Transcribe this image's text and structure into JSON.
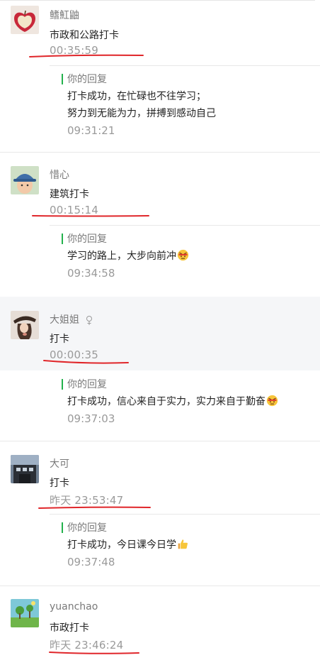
{
  "posts": [
    {
      "user": "鳍魟鼬",
      "text": "市政和公路打卡",
      "time": "00:35:59",
      "reply": {
        "label": "你的回复",
        "line1": "打卡成功，在忙碌也不往学习；",
        "line2": "努力到无能为力，拼搏到感动自己",
        "time": "09:31:21"
      }
    },
    {
      "user": "惜心",
      "text": "建筑打卡",
      "time": "00:15:14",
      "reply": {
        "label": "你的回复",
        "line1": "学习的路上，大步向前冲",
        "time": "09:34:58"
      }
    },
    {
      "user": "大姐姐",
      "text": "打卡",
      "time": "00:00:35",
      "reply": {
        "label": "你的回复",
        "line1": "打卡成功，信心来自于实力，实力来自于勤奋",
        "time": "09:37:03"
      }
    },
    {
      "user": "大可",
      "text": "打卡",
      "time": "昨天 23:53:47",
      "reply": {
        "label": "你的回复",
        "line1": "打卡成功，今日课今日学",
        "time": "09:37:48"
      }
    },
    {
      "user": "yuanchao",
      "text": "市政打卡",
      "time": "昨天 23:46:24"
    }
  ],
  "icons": {
    "emoji_1": "determined-face-emoji",
    "emoji_2": "determined-face-emoji",
    "emoji_3": "thumbs-up-emoji",
    "gender": "female-icon"
  },
  "colors": {
    "reply_bar": "#22b14c",
    "annotation_underline": "#e0262a"
  }
}
